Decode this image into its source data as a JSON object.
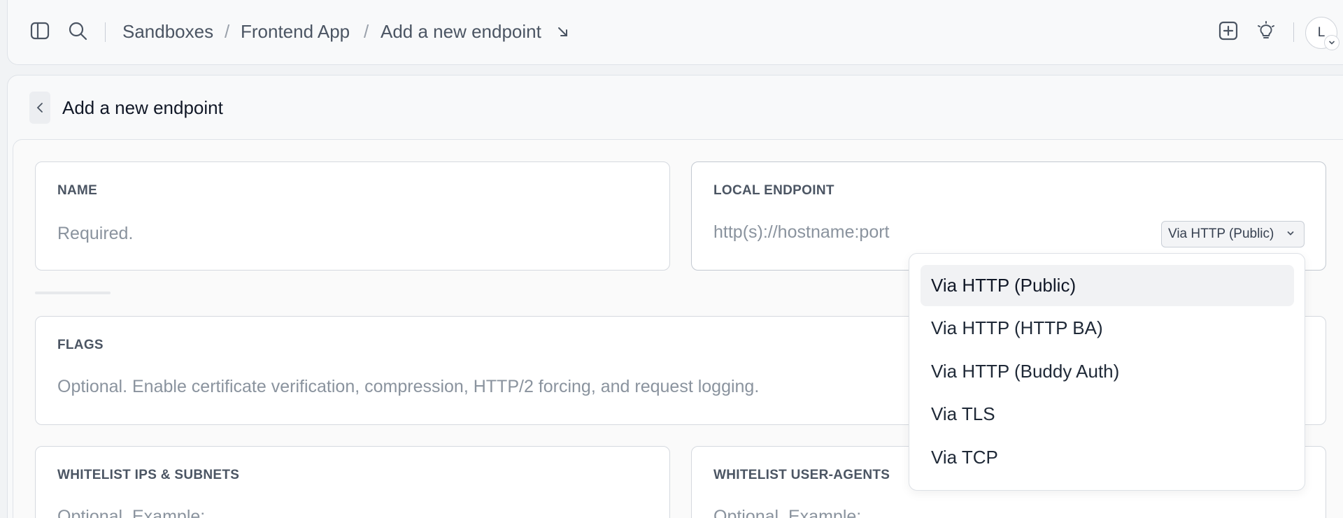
{
  "breadcrumb": {
    "items": [
      "Sandboxes",
      "Frontend App",
      "Add a new endpoint"
    ],
    "separator": "/"
  },
  "user": {
    "initial": "L"
  },
  "page": {
    "title": "Add a new endpoint"
  },
  "form": {
    "name": {
      "label": "NAME",
      "placeholder": "Required."
    },
    "local_endpoint": {
      "label": "LOCAL ENDPOINT",
      "placeholder": "http(s)://hostname:port",
      "protocol_selected": "Via HTTP (Public)"
    },
    "flags": {
      "label": "FLAGS",
      "placeholder": "Optional. Enable certificate verification, compression, HTTP/2 forcing, and request logging."
    },
    "whitelist_ips": {
      "label": "WHITELIST IPS & SUBNETS",
      "placeholder": "Optional. Example:"
    },
    "whitelist_agents": {
      "label": "WHITELIST USER-AGENTS",
      "placeholder": "Optional. Example:"
    }
  },
  "protocol_dropdown": {
    "options": [
      "Via HTTP (Public)",
      "Via HTTP (HTTP BA)",
      "Via HTTP (Buddy Auth)",
      "Via TLS",
      "Via TCP"
    ],
    "selected_index": 0
  },
  "icons": [
    "sidebar-toggle-icon",
    "search-icon",
    "arrow-down-right-icon",
    "add-square-icon",
    "lightbulb-icon",
    "chevron-left-icon",
    "chevron-down-icon"
  ]
}
